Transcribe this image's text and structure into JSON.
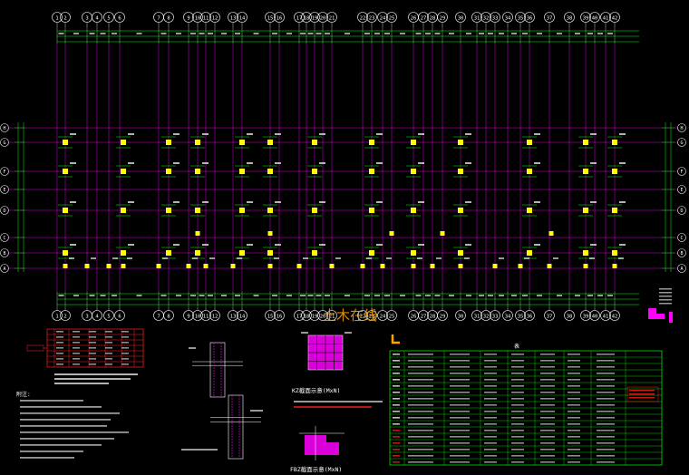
{
  "drawing": {
    "axis_numbers": [
      "1",
      "2",
      "3",
      "4",
      "5",
      "6",
      "7",
      "8",
      "9",
      "10",
      "11",
      "12",
      "13",
      "14",
      "15",
      "16",
      "17",
      "18",
      "19",
      "20",
      "21",
      "22",
      "23",
      "24",
      "25",
      "26",
      "27",
      "28",
      "29",
      "30",
      "31",
      "32",
      "33",
      "34",
      "35",
      "36",
      "37",
      "38",
      "39",
      "40",
      "41",
      "42",
      "43"
    ],
    "row_labels": [
      "H",
      "G",
      "F",
      "E",
      "D",
      "C",
      "B",
      "A"
    ],
    "watermark": "土木在线",
    "kz_section_title": "KZ截面示意(MxN)",
    "fbz_section_title": "FBZ截面示意(MxN)",
    "table_header": "表",
    "notes_title": "附注:",
    "colors": {
      "background": "#000000",
      "axis": "#ff00ff",
      "dimension": "#00ff00",
      "column": "#ffff00",
      "text": "#ffffff",
      "table_line": "#00ff00",
      "section_fill": "#ff00ff",
      "note_red": "#ff2020",
      "orange": "#ffa500"
    }
  }
}
